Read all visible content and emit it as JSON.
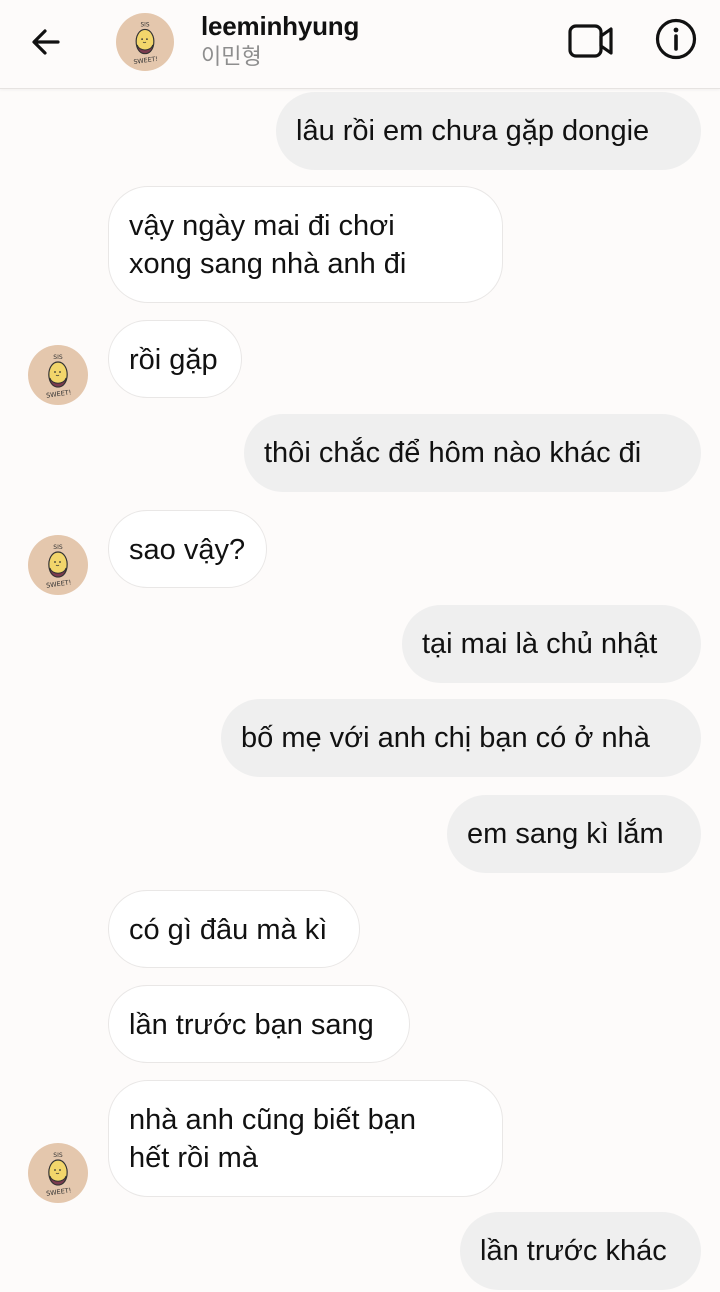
{
  "header": {
    "username": "leeminhyung",
    "subname": "이민형"
  },
  "colors": {
    "background": "#fdfbfa",
    "outgoing_bubble": "#efefef",
    "incoming_bubble": "#ffffff",
    "avatar_bg": "#e4c7ad"
  },
  "icons": {
    "back": "arrow-left-icon",
    "video": "video-camera-icon",
    "info": "info-icon",
    "avatar": "sweet-potato-avatar",
    "avatar_caption": "SWEET!"
  },
  "messages": [
    {
      "direction": "out",
      "lines": [
        "lâu rồi em chưa gặp dongie"
      ]
    },
    {
      "direction": "in",
      "lines": [
        "vậy ngày mai đi chơi",
        "xong sang nhà anh đi"
      ]
    },
    {
      "direction": "in",
      "lines": [
        "rồi gặp"
      ],
      "avatar": true
    },
    {
      "direction": "out",
      "lines": [
        "thôi chắc để hôm nào khác đi"
      ]
    },
    {
      "direction": "in",
      "lines": [
        "sao vậy?"
      ],
      "avatar": true
    },
    {
      "direction": "out",
      "lines": [
        "tại mai là chủ nhật"
      ]
    },
    {
      "direction": "out",
      "lines": [
        "bố mẹ với anh chị bạn có ở nhà"
      ]
    },
    {
      "direction": "out",
      "lines": [
        "em sang kì lắm"
      ]
    },
    {
      "direction": "in",
      "lines": [
        "có gì đâu mà kì"
      ]
    },
    {
      "direction": "in",
      "lines": [
        "lần trước bạn sang"
      ]
    },
    {
      "direction": "in",
      "lines": [
        "nhà anh cũng biết bạn",
        "hết rồi mà"
      ],
      "avatar": true
    },
    {
      "direction": "out",
      "lines": [
        "lần trước khác"
      ]
    }
  ]
}
